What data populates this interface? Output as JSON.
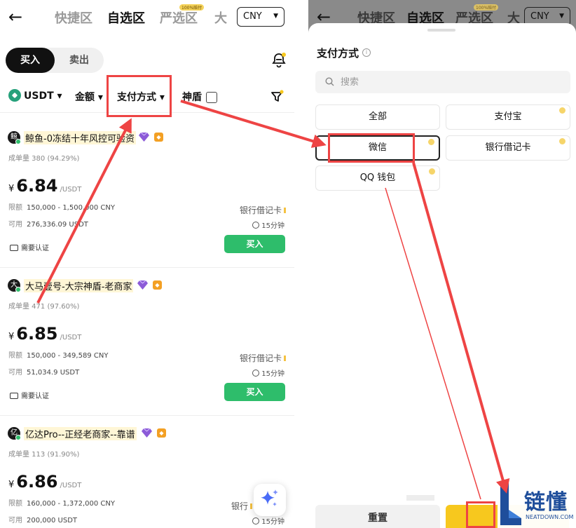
{
  "nav": {
    "back": "←",
    "tabs": [
      "快捷区",
      "自选区",
      "严选区",
      "大"
    ],
    "badge": "100%赔付",
    "currency": "CNY",
    "caret": "▼"
  },
  "trade": {
    "buy": "买入",
    "sell": "卖出"
  },
  "filters": {
    "coin": "USDT",
    "amount": "金额",
    "payment": "支付方式",
    "shield": "神盾",
    "caret": "▾"
  },
  "listings": [
    {
      "avatar": "鲸",
      "merchant": "鲸鱼-0冻结十年风控可验资",
      "volume": "成单量 380 (94.29%)",
      "currency_symbol": "¥",
      "price": "6.84",
      "unit": "/USDT",
      "limit_label": "限额",
      "limit": "150,000 - 1,500,000 CNY",
      "available_label": "可用",
      "available": "276,336.09 USDT",
      "pay_method": "银行借记卡",
      "time": "15分钟",
      "verify": "需要认证",
      "buy": "买入"
    },
    {
      "avatar": "大",
      "merchant": "大马壹号-大宗神盾-老商家",
      "volume": "成单量 471 (97.60%)",
      "currency_symbol": "¥",
      "price": "6.85",
      "unit": "/USDT",
      "limit_label": "限额",
      "limit": "150,000 - 349,589 CNY",
      "available_label": "可用",
      "available": "51,034.9 USDT",
      "pay_method": "银行借记卡",
      "time": "15分钟",
      "verify": "需要认证",
      "buy": "买入"
    },
    {
      "avatar": "亿",
      "merchant": "亿达Pro--正经老商家--靠谱",
      "volume": "成单量 113 (91.90%)",
      "currency_symbol": "¥",
      "price": "6.86",
      "unit": "/USDT",
      "limit_label": "限额",
      "limit": "160,000 - 1,372,000 CNY",
      "available_label": "可用",
      "available": "200,000 USDT",
      "pay_method": "银行",
      "time": "15分钟"
    }
  ],
  "sheet": {
    "title": "支付方式",
    "info": "i",
    "search_placeholder": "搜索",
    "options": [
      "全部",
      "支付宝",
      "微信",
      "银行借记卡",
      "QQ 钱包"
    ],
    "reset": "重置"
  },
  "watermark": {
    "text": "链懂",
    "sub": "NEATDOWN.COM"
  },
  "colors": {
    "accent_green": "#2ebd6b",
    "confirm_yellow": "#f7c81e",
    "annotation_red": "#ee4444",
    "overlay_gray": "#8a8a8a",
    "watermark_blue": "#1f4e9b"
  }
}
